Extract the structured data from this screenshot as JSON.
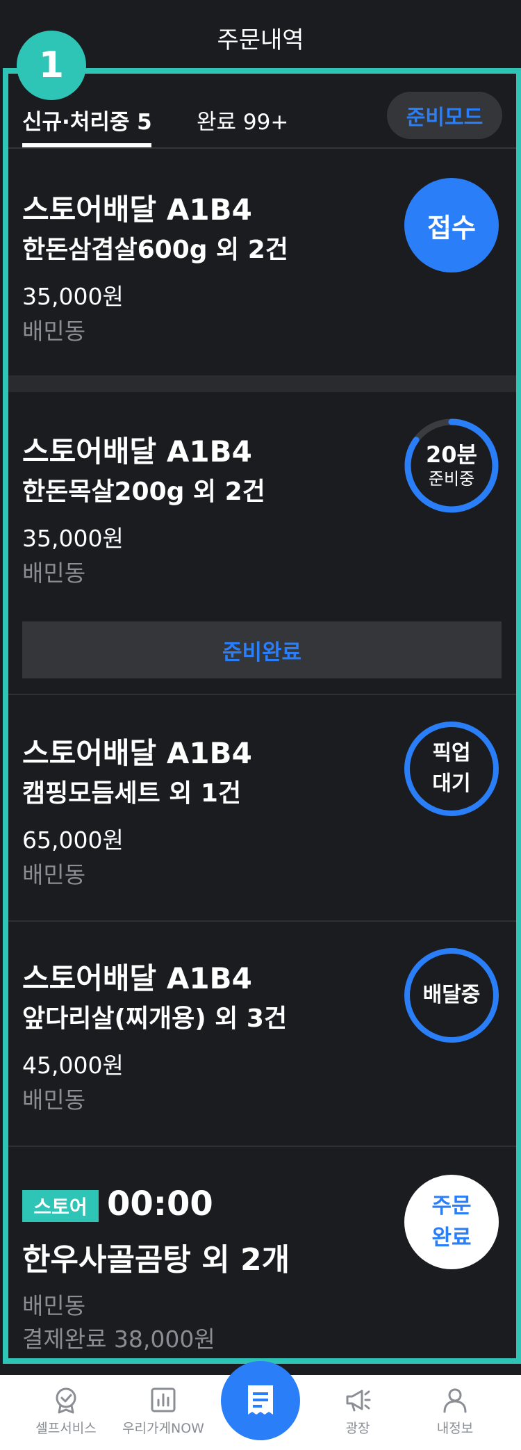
{
  "header": {
    "title": "주문내역"
  },
  "step_badge": "1",
  "tabs": {
    "new_processing": "신규·처리중 5",
    "completed": "완료 99+",
    "mode_button": "준비모드"
  },
  "orders": [
    {
      "shop": "스토어배달 A1B4",
      "menu": "한돈삼겹살600g 외 2건",
      "price": "35,000원",
      "area": "배민동",
      "status": "접수"
    },
    {
      "shop": "스토어배달 A1B4",
      "menu": "한돈목살200g 외 2건",
      "price": "35,000원",
      "area": "배민동",
      "timer_minutes": "20분",
      "timer_label": "준비중",
      "timer_progress": 0.85,
      "action": "준비완료"
    },
    {
      "shop": "스토어배달 A1B4",
      "menu": "캠핑모듬세트 외 1건",
      "price": "65,000원",
      "area": "배민동",
      "status_line1": "픽업",
      "status_line2": "대기"
    },
    {
      "shop": "스토어배달 A1B4",
      "menu": "앞다리살(찌개용) 외 3건",
      "price": "45,000원",
      "area": "배민동",
      "status": "배달중"
    },
    {
      "badge": "스토어",
      "time": "00:00",
      "menu": "한우사골곰탕 외 2개",
      "area": "배민동",
      "payment": "결제완료 38,000원",
      "status_line1": "주문",
      "status_line2": "완료"
    }
  ],
  "bottom_nav": {
    "items": [
      "셀프서비스",
      "우리가게NOW",
      "광장",
      "내정보"
    ]
  },
  "colors": {
    "accent_blue": "#2a7ef7",
    "highlight_teal": "#2ec4b6",
    "background": "#1b1c1f",
    "surface": "#34363a"
  }
}
